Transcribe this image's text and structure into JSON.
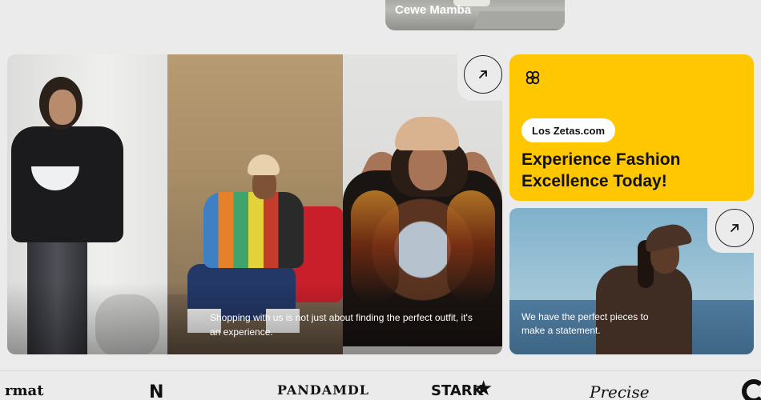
{
  "top_card": {
    "label": "Cewe Mamba"
  },
  "collage": {
    "caption": "Shopping with us is not just about finding the perfect outfit, it's an experience."
  },
  "promo": {
    "pill": "Los Zetas.com",
    "headline": "Experience Fashion Excellence Today!",
    "icon": "clover-logo-icon",
    "background": "#fec701"
  },
  "card2": {
    "caption": "We have the perfect pieces to make a statement."
  },
  "icons": {
    "arrow": "arrow-up-right-icon"
  },
  "brands": [
    "rmat",
    "N",
    "PANDAMDL",
    "STARK",
    "Precise"
  ]
}
